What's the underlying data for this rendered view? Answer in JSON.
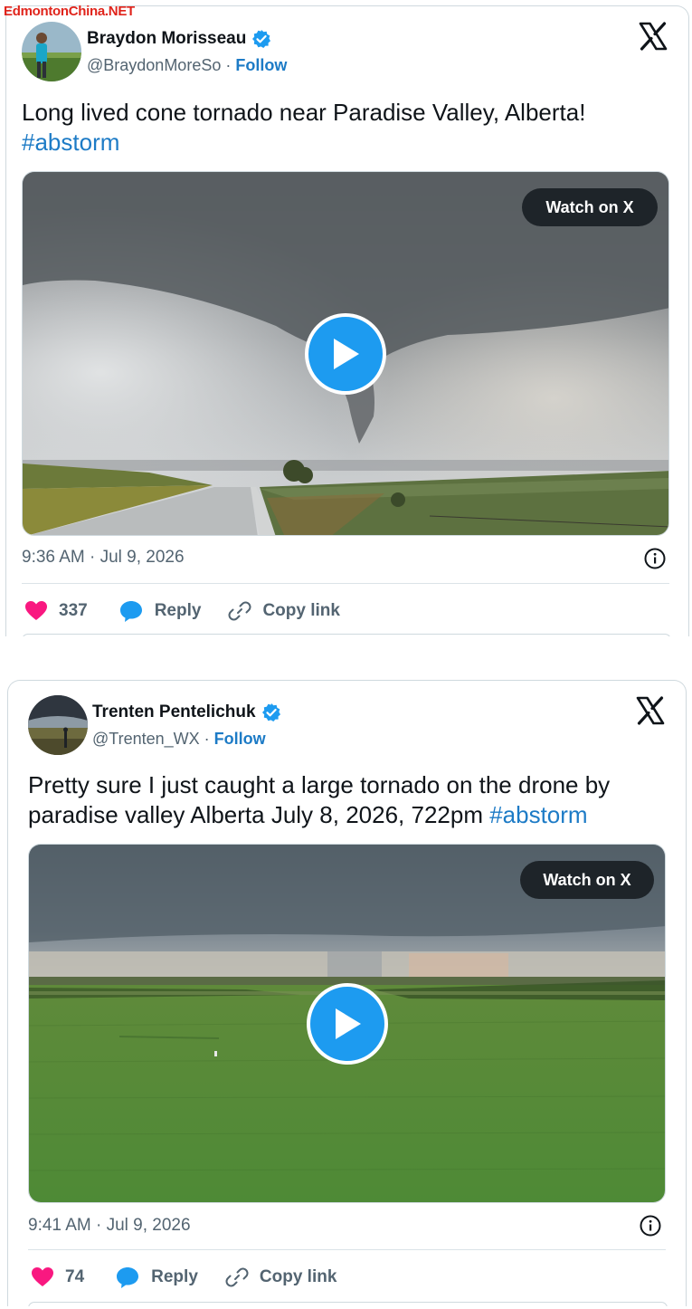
{
  "watermark": "EdmontonChina.NET",
  "colors": {
    "brand_blue": "#1d9bf0",
    "link_blue": "#1d7bc6",
    "like_red": "#f91880",
    "muted": "#536471"
  },
  "tweets": [
    {
      "author_name": "Braydon Morisseau",
      "handle": "@BraydonMoreSo",
      "separator": " · ",
      "follow_label": "Follow",
      "text_line1": "Long lived cone tornado near Paradise Valley, Alberta!",
      "hashtag": "#abstorm",
      "watch_label": "Watch on X",
      "timestamp": "9:36 AM · Jul 9, 2026",
      "likes": "337",
      "reply_label": "Reply",
      "copy_label": "Copy link",
      "icons": [
        "verified-badge-icon",
        "x-logo-icon",
        "play-icon",
        "info-icon",
        "heart-icon",
        "reply-bubble-icon",
        "link-icon"
      ]
    },
    {
      "author_name": "Trenten Pentelichuk",
      "handle": "@Trenten_WX",
      "separator": " · ",
      "follow_label": "Follow",
      "text_line1": "Pretty sure I just caught a large tornado on the drone by",
      "text_line2": "paradise valley Alberta July 8, 2026, 722pm ",
      "hashtag": "#abstorm",
      "watch_label": "Watch on X",
      "timestamp": "9:41 AM · Jul 9, 2026",
      "likes": "74",
      "reply_label": "Reply",
      "copy_label": "Copy link",
      "icons": [
        "verified-badge-icon",
        "x-logo-icon",
        "play-icon",
        "info-icon",
        "heart-icon",
        "reply-bubble-icon",
        "link-icon"
      ]
    }
  ]
}
